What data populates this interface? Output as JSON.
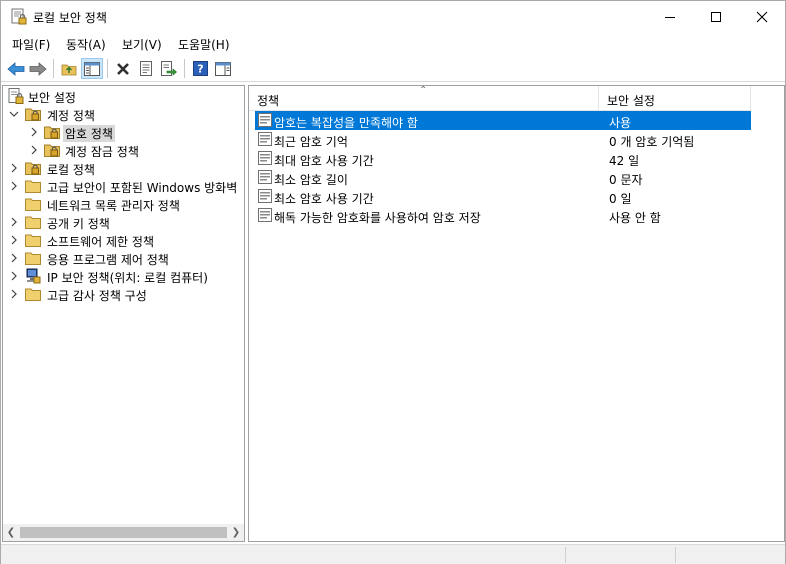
{
  "window": {
    "title": "로컬 보안 정책",
    "app_icon": "security-policy-icon"
  },
  "menu": [
    "파일(F)",
    "동작(A)",
    "보기(V)",
    "도움말(H)"
  ],
  "toolbar": {
    "buttons": [
      "back-icon",
      "forward-icon",
      "up-folder-icon",
      "show-hide-tree-icon",
      "delete-icon",
      "properties-icon",
      "export-list-icon",
      "help-icon",
      "show-action-pane-icon"
    ]
  },
  "tree": {
    "root": "보안 설정",
    "items": [
      {
        "label": "계정 정책"
      },
      {
        "label": "암호 정책"
      },
      {
        "label": "계정 잠금 정책"
      },
      {
        "label": "로컬 정책"
      },
      {
        "label": "고급 보안이 포함된 Windows 방화벽"
      },
      {
        "label": "네트워크 목록 관리자 정책"
      },
      {
        "label": "공개 키 정책"
      },
      {
        "label": "소프트웨어 제한 정책"
      },
      {
        "label": "응용 프로그램 제어 정책"
      },
      {
        "label": "IP 보안 정책(위치: 로컬 컴퓨터)"
      },
      {
        "label": "고급 감사 정책 구성"
      }
    ]
  },
  "list": {
    "columns": [
      "정책",
      "보안 설정"
    ],
    "rows": [
      {
        "policy": "암호는 복잡성을 만족해야 함",
        "setting": "사용"
      },
      {
        "policy": "최근 암호 기억",
        "setting": "0 개 암호 기억됨"
      },
      {
        "policy": "최대 암호 사용 기간",
        "setting": "42 일"
      },
      {
        "policy": "최소 암호 길이",
        "setting": "0 문자"
      },
      {
        "policy": "최소 암호 사용 기간",
        "setting": "0 일"
      },
      {
        "policy": "해독 가능한 암호화를 사용하여 암호 저장",
        "setting": "사용 안 함"
      }
    ]
  },
  "colors": {
    "selection": "#0078d7",
    "tree_selection": "#d9d9d9",
    "folder": "#e8c15a",
    "toolbar_pressed": "#cce4f7"
  }
}
